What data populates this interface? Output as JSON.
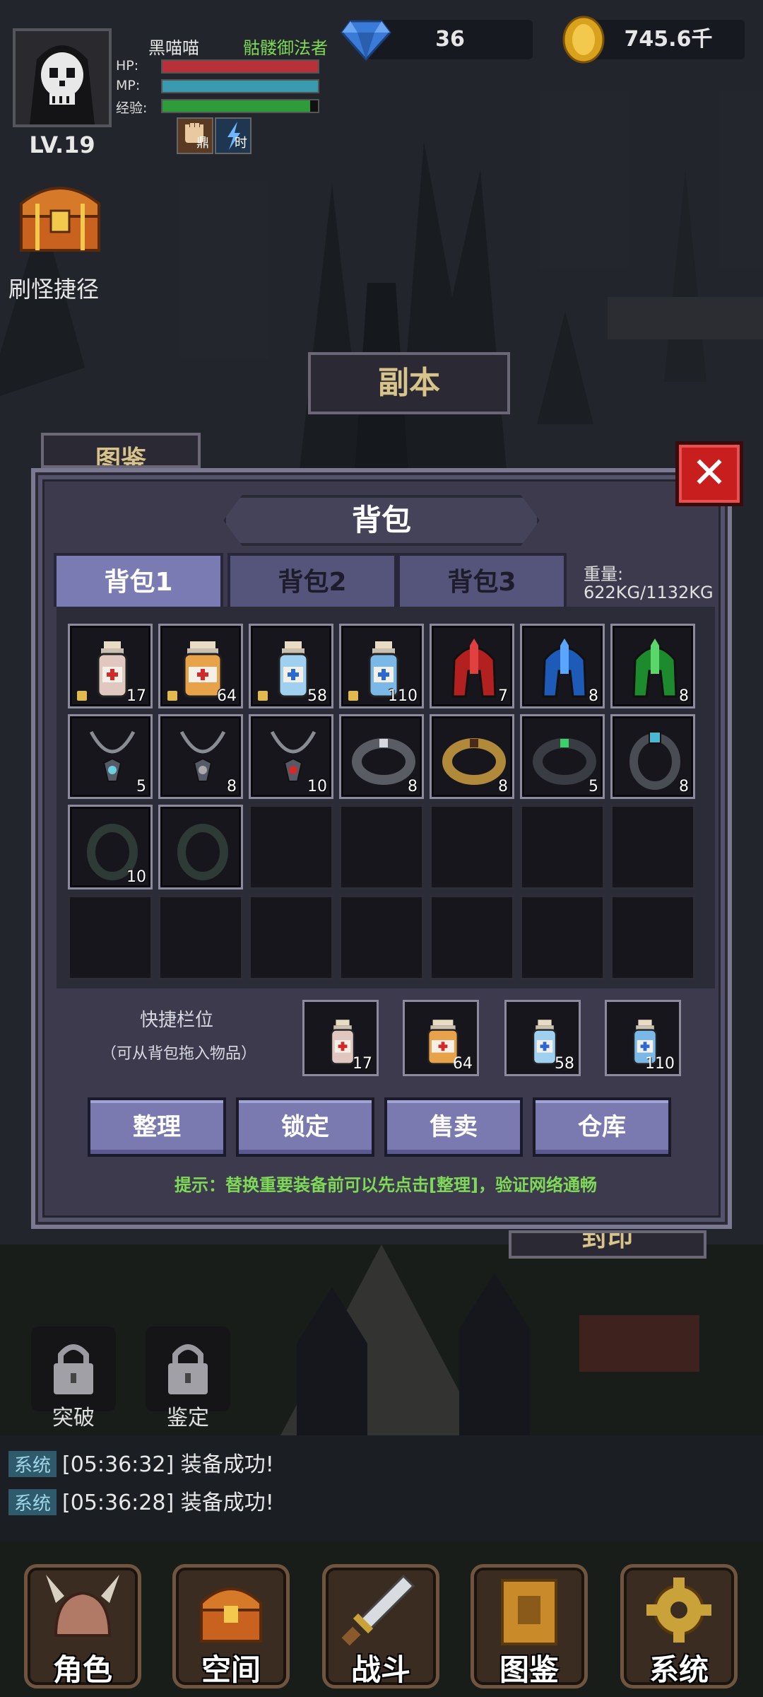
{
  "player": {
    "name": "黑喵喵",
    "title": "骷髅御法者",
    "level": "LV.19",
    "hp_label": "HP:",
    "mp_label": "MP:",
    "exp_label": "经验:",
    "hp_fraction": 1.0,
    "mp_fraction": 1.0,
    "exp_fraction": 0.95,
    "buffs": [
      {
        "label": "鼎",
        "icon": "fist-icon"
      },
      {
        "label": "时",
        "icon": "lightning-icon"
      }
    ]
  },
  "currency": {
    "gems": "36",
    "gold": "745.6千"
  },
  "shortcut": {
    "label": "刷怪捷径"
  },
  "background_signs": {
    "dungeon": "副本",
    "gallery": "图鉴",
    "seal": "封印"
  },
  "bag": {
    "title": "背包",
    "tabs": [
      "背包1",
      "背包2",
      "背包3"
    ],
    "active_tab": 0,
    "weight_label": "重量:",
    "weight_value": "622KG/1132KG",
    "items": [
      {
        "icon": "red-potion-small",
        "count": "17",
        "locked": true
      },
      {
        "icon": "red-potion-large",
        "count": "64",
        "locked": true
      },
      {
        "icon": "blue-potion-small",
        "count": "58",
        "locked": true
      },
      {
        "icon": "blue-potion-large",
        "count": "110",
        "locked": true
      },
      {
        "icon": "red-helmet",
        "count": "7",
        "locked": false
      },
      {
        "icon": "blue-helmet",
        "count": "8",
        "locked": false
      },
      {
        "icon": "green-helmet",
        "count": "8",
        "locked": false
      },
      {
        "icon": "silver-necklace",
        "count": "5",
        "locked": false
      },
      {
        "icon": "dark-necklace",
        "count": "8",
        "locked": false
      },
      {
        "icon": "red-gem-necklace",
        "count": "10",
        "locked": false
      },
      {
        "icon": "iron-bracer",
        "count": "8",
        "locked": false
      },
      {
        "icon": "gold-bracelet",
        "count": "8",
        "locked": false
      },
      {
        "icon": "jeweled-bracelet",
        "count": "5",
        "locked": false
      },
      {
        "icon": "gem-ring",
        "count": "8",
        "locked": false
      },
      {
        "icon": "dark-ring",
        "count": "10",
        "locked": false
      },
      {
        "icon": "dark-ring-2",
        "count": "",
        "locked": false
      }
    ],
    "quick_label": "快捷栏位",
    "quick_sub": "（可从背包拖入物品）",
    "quick_items": [
      {
        "icon": "red-potion-small",
        "count": "17"
      },
      {
        "icon": "red-potion-large",
        "count": "64"
      },
      {
        "icon": "blue-potion-small",
        "count": "58"
      },
      {
        "icon": "blue-potion-large",
        "count": "110"
      }
    ],
    "actions": [
      "整理",
      "锁定",
      "售卖",
      "仓库"
    ],
    "tip": "提示：替换重要装备前可以先点击[整理]，验证网络通畅"
  },
  "side_buttons": [
    {
      "label": "突破"
    },
    {
      "label": "鉴定"
    }
  ],
  "log": [
    {
      "tag": "系统",
      "text": "[05:36:32] 装备成功!"
    },
    {
      "tag": "系统",
      "text": "[05:36:28] 装备成功!"
    }
  ],
  "nav": [
    {
      "label": "角色",
      "icon": "helmet-icon"
    },
    {
      "label": "空间",
      "icon": "chest-icon"
    },
    {
      "label": "战斗",
      "icon": "sword-icon"
    },
    {
      "label": "图鉴",
      "icon": "book-icon"
    },
    {
      "label": "系统",
      "icon": "gear-icon"
    }
  ],
  "colors": {
    "hp": "#b8303a",
    "mp": "#3a9ab0",
    "exp": "#2e9c3a",
    "title_green": "#7ed957",
    "panel": "#55536b",
    "tab_active": "#7a7bb3",
    "button": "#7a79b0",
    "close": "#c91e1e"
  }
}
